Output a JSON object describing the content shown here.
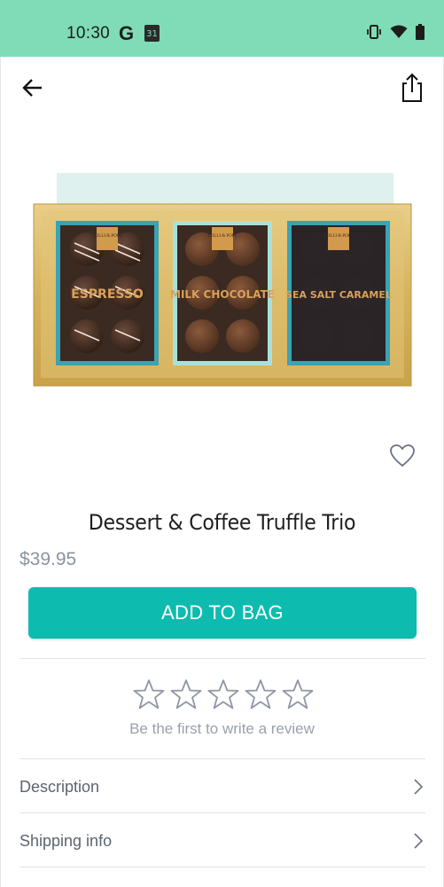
{
  "status_bar": {
    "time": "10:30",
    "g_glyph": "G",
    "calendar_day": "31",
    "icons": [
      "vibrate-icon",
      "wifi-icon",
      "battery-icon"
    ]
  },
  "header": {
    "back_icon": "back-arrow-icon",
    "share_icon": "share-icon"
  },
  "product": {
    "image_labels": {
      "brand": "LOLLI & POPS",
      "box1": "ESPRESSO",
      "box2": "MILK CHOCOLATE",
      "box3": "SEA SALT CARAMEL"
    },
    "title": "Dessert & Coffee Truffle Trio",
    "price": "$39.95",
    "wishlist_icon": "heart-outline-icon"
  },
  "actions": {
    "add_to_bag_label": "ADD TO BAG"
  },
  "reviews": {
    "rating": 0,
    "max_rating": 5,
    "prompt": "Be the first to write a review"
  },
  "sections": [
    {
      "label": "Description"
    },
    {
      "label": "Shipping info"
    }
  ],
  "colors": {
    "status_bar": "#7fdcb7",
    "accent": "#0dbcaf",
    "price": "#8b93a0"
  }
}
